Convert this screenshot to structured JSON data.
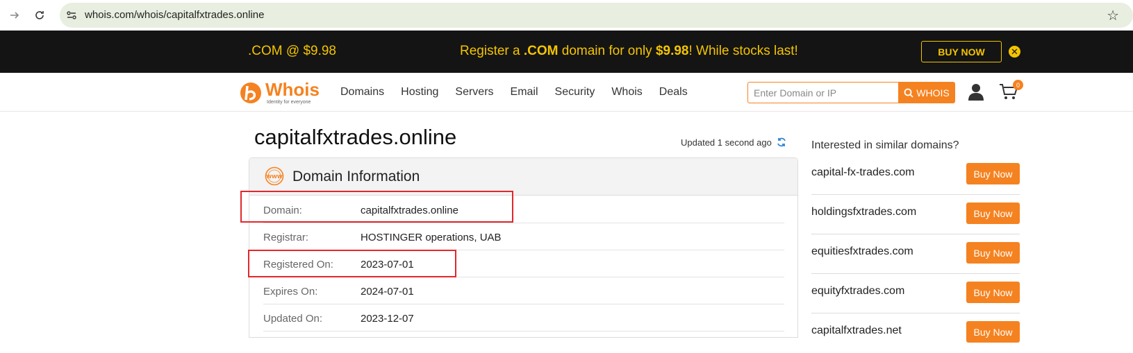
{
  "browser": {
    "url": "whois.com/whois/capitalfxtrades.online"
  },
  "promo": {
    "left_text": ".COM @ $9.98",
    "center_pre": "Register a ",
    "center_bold1": ".COM",
    "center_mid": " domain for only ",
    "center_bold2": "$9.98",
    "center_post": "! While stocks last!",
    "buy_label": "BUY NOW",
    "accent": "#f4c400"
  },
  "header": {
    "logo_text": "Whois",
    "logo_tagline": "Identity for everyone",
    "nav": [
      "Domains",
      "Hosting",
      "Servers",
      "Email",
      "Security",
      "Whois",
      "Deals"
    ],
    "search_placeholder": "Enter Domain or IP",
    "search_button": "WHOIS",
    "cart_count": "0",
    "accent": "#f58220"
  },
  "main": {
    "domain_title": "capitalfxtrades.online",
    "updated_text": "Updated 1 second ago",
    "panel_title": "Domain Information",
    "rows": [
      {
        "key": "Domain:",
        "value": "capitalfxtrades.online"
      },
      {
        "key": "Registrar:",
        "value": "HOSTINGER operations, UAB"
      },
      {
        "key": "Registered On:",
        "value": "2023-07-01"
      },
      {
        "key": "Expires On:",
        "value": "2024-07-01"
      },
      {
        "key": "Updated On:",
        "value": "2023-12-07"
      }
    ],
    "highlight_color": "#e3262b"
  },
  "sidebar": {
    "heading": "Interested in similar domains?",
    "buy_label": "Buy Now",
    "suggestions": [
      "capital-fx-trades.com",
      "holdingsfxtrades.com",
      "equitiesfxtrades.com",
      "equityfxtrades.com",
      "capitalfxtrades.net"
    ]
  }
}
